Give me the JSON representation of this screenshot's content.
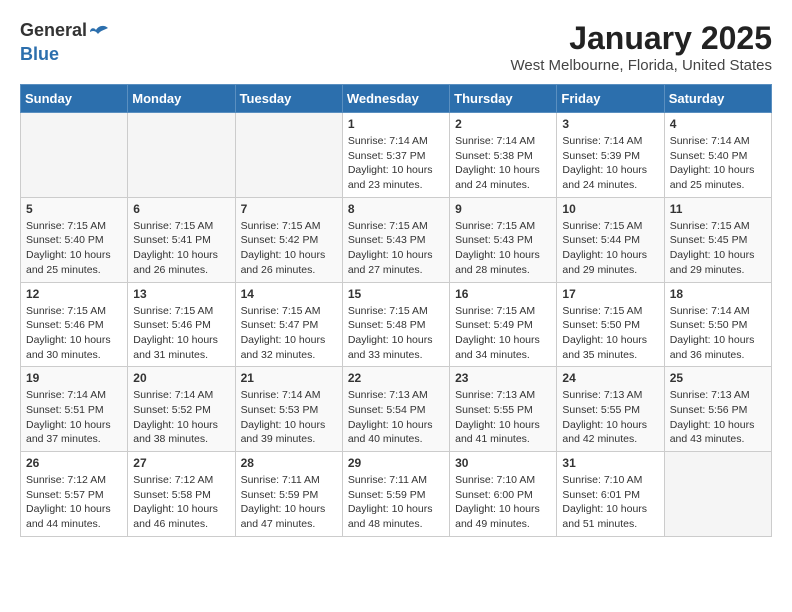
{
  "header": {
    "logo_general": "General",
    "logo_blue": "Blue",
    "month_title": "January 2025",
    "location": "West Melbourne, Florida, United States"
  },
  "days_of_week": [
    "Sunday",
    "Monday",
    "Tuesday",
    "Wednesday",
    "Thursday",
    "Friday",
    "Saturday"
  ],
  "weeks": [
    [
      {
        "day": "",
        "sunrise": "",
        "sunset": "",
        "daylight": ""
      },
      {
        "day": "",
        "sunrise": "",
        "sunset": "",
        "daylight": ""
      },
      {
        "day": "",
        "sunrise": "",
        "sunset": "",
        "daylight": ""
      },
      {
        "day": "1",
        "sunrise": "Sunrise: 7:14 AM",
        "sunset": "Sunset: 5:37 PM",
        "daylight": "Daylight: 10 hours and 23 minutes."
      },
      {
        "day": "2",
        "sunrise": "Sunrise: 7:14 AM",
        "sunset": "Sunset: 5:38 PM",
        "daylight": "Daylight: 10 hours and 24 minutes."
      },
      {
        "day": "3",
        "sunrise": "Sunrise: 7:14 AM",
        "sunset": "Sunset: 5:39 PM",
        "daylight": "Daylight: 10 hours and 24 minutes."
      },
      {
        "day": "4",
        "sunrise": "Sunrise: 7:14 AM",
        "sunset": "Sunset: 5:40 PM",
        "daylight": "Daylight: 10 hours and 25 minutes."
      }
    ],
    [
      {
        "day": "5",
        "sunrise": "Sunrise: 7:15 AM",
        "sunset": "Sunset: 5:40 PM",
        "daylight": "Daylight: 10 hours and 25 minutes."
      },
      {
        "day": "6",
        "sunrise": "Sunrise: 7:15 AM",
        "sunset": "Sunset: 5:41 PM",
        "daylight": "Daylight: 10 hours and 26 minutes."
      },
      {
        "day": "7",
        "sunrise": "Sunrise: 7:15 AM",
        "sunset": "Sunset: 5:42 PM",
        "daylight": "Daylight: 10 hours and 26 minutes."
      },
      {
        "day": "8",
        "sunrise": "Sunrise: 7:15 AM",
        "sunset": "Sunset: 5:43 PM",
        "daylight": "Daylight: 10 hours and 27 minutes."
      },
      {
        "day": "9",
        "sunrise": "Sunrise: 7:15 AM",
        "sunset": "Sunset: 5:43 PM",
        "daylight": "Daylight: 10 hours and 28 minutes."
      },
      {
        "day": "10",
        "sunrise": "Sunrise: 7:15 AM",
        "sunset": "Sunset: 5:44 PM",
        "daylight": "Daylight: 10 hours and 29 minutes."
      },
      {
        "day": "11",
        "sunrise": "Sunrise: 7:15 AM",
        "sunset": "Sunset: 5:45 PM",
        "daylight": "Daylight: 10 hours and 29 minutes."
      }
    ],
    [
      {
        "day": "12",
        "sunrise": "Sunrise: 7:15 AM",
        "sunset": "Sunset: 5:46 PM",
        "daylight": "Daylight: 10 hours and 30 minutes."
      },
      {
        "day": "13",
        "sunrise": "Sunrise: 7:15 AM",
        "sunset": "Sunset: 5:46 PM",
        "daylight": "Daylight: 10 hours and 31 minutes."
      },
      {
        "day": "14",
        "sunrise": "Sunrise: 7:15 AM",
        "sunset": "Sunset: 5:47 PM",
        "daylight": "Daylight: 10 hours and 32 minutes."
      },
      {
        "day": "15",
        "sunrise": "Sunrise: 7:15 AM",
        "sunset": "Sunset: 5:48 PM",
        "daylight": "Daylight: 10 hours and 33 minutes."
      },
      {
        "day": "16",
        "sunrise": "Sunrise: 7:15 AM",
        "sunset": "Sunset: 5:49 PM",
        "daylight": "Daylight: 10 hours and 34 minutes."
      },
      {
        "day": "17",
        "sunrise": "Sunrise: 7:15 AM",
        "sunset": "Sunset: 5:50 PM",
        "daylight": "Daylight: 10 hours and 35 minutes."
      },
      {
        "day": "18",
        "sunrise": "Sunrise: 7:14 AM",
        "sunset": "Sunset: 5:50 PM",
        "daylight": "Daylight: 10 hours and 36 minutes."
      }
    ],
    [
      {
        "day": "19",
        "sunrise": "Sunrise: 7:14 AM",
        "sunset": "Sunset: 5:51 PM",
        "daylight": "Daylight: 10 hours and 37 minutes."
      },
      {
        "day": "20",
        "sunrise": "Sunrise: 7:14 AM",
        "sunset": "Sunset: 5:52 PM",
        "daylight": "Daylight: 10 hours and 38 minutes."
      },
      {
        "day": "21",
        "sunrise": "Sunrise: 7:14 AM",
        "sunset": "Sunset: 5:53 PM",
        "daylight": "Daylight: 10 hours and 39 minutes."
      },
      {
        "day": "22",
        "sunrise": "Sunrise: 7:13 AM",
        "sunset": "Sunset: 5:54 PM",
        "daylight": "Daylight: 10 hours and 40 minutes."
      },
      {
        "day": "23",
        "sunrise": "Sunrise: 7:13 AM",
        "sunset": "Sunset: 5:55 PM",
        "daylight": "Daylight: 10 hours and 41 minutes."
      },
      {
        "day": "24",
        "sunrise": "Sunrise: 7:13 AM",
        "sunset": "Sunset: 5:55 PM",
        "daylight": "Daylight: 10 hours and 42 minutes."
      },
      {
        "day": "25",
        "sunrise": "Sunrise: 7:13 AM",
        "sunset": "Sunset: 5:56 PM",
        "daylight": "Daylight: 10 hours and 43 minutes."
      }
    ],
    [
      {
        "day": "26",
        "sunrise": "Sunrise: 7:12 AM",
        "sunset": "Sunset: 5:57 PM",
        "daylight": "Daylight: 10 hours and 44 minutes."
      },
      {
        "day": "27",
        "sunrise": "Sunrise: 7:12 AM",
        "sunset": "Sunset: 5:58 PM",
        "daylight": "Daylight: 10 hours and 46 minutes."
      },
      {
        "day": "28",
        "sunrise": "Sunrise: 7:11 AM",
        "sunset": "Sunset: 5:59 PM",
        "daylight": "Daylight: 10 hours and 47 minutes."
      },
      {
        "day": "29",
        "sunrise": "Sunrise: 7:11 AM",
        "sunset": "Sunset: 5:59 PM",
        "daylight": "Daylight: 10 hours and 48 minutes."
      },
      {
        "day": "30",
        "sunrise": "Sunrise: 7:10 AM",
        "sunset": "Sunset: 6:00 PM",
        "daylight": "Daylight: 10 hours and 49 minutes."
      },
      {
        "day": "31",
        "sunrise": "Sunrise: 7:10 AM",
        "sunset": "Sunset: 6:01 PM",
        "daylight": "Daylight: 10 hours and 51 minutes."
      },
      {
        "day": "",
        "sunrise": "",
        "sunset": "",
        "daylight": ""
      }
    ]
  ]
}
